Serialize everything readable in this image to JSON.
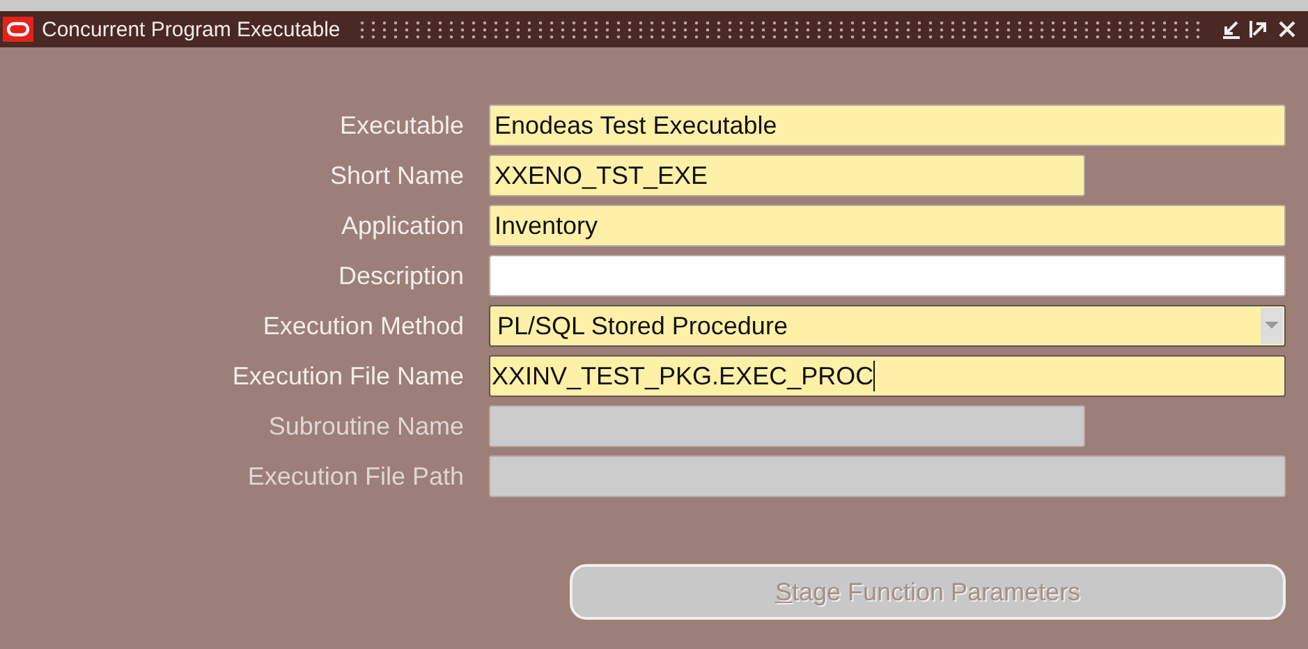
{
  "window": {
    "title": "Concurrent Program Executable"
  },
  "fields": [
    {
      "label": "Executable",
      "value": "Enodeas Test Executable",
      "kind": "text",
      "required": true,
      "disabled": false,
      "wide": true,
      "focused": false
    },
    {
      "label": "Short Name",
      "value": "XXENO_TST_EXE",
      "kind": "text",
      "required": true,
      "disabled": false,
      "wide": false,
      "focused": false
    },
    {
      "label": "Application",
      "value": "Inventory",
      "kind": "text",
      "required": true,
      "disabled": false,
      "wide": true,
      "focused": false
    },
    {
      "label": "Description",
      "kind": "text",
      "required": false,
      "disabled": false,
      "wide": true,
      "focused": false
    },
    {
      "label": "Execution Method",
      "value": "PL/SQL Stored Procedure",
      "kind": "list",
      "required": true,
      "disabled": false,
      "wide": true,
      "focused": false
    },
    {
      "label": "Execution File Name",
      "value": "XXINV_TEST_PKG.EXEC_PROC",
      "kind": "text",
      "required": true,
      "disabled": false,
      "wide": true,
      "focused": true
    },
    {
      "label": "Subroutine Name",
      "kind": "text",
      "required": false,
      "disabled": true,
      "wide": false,
      "focused": false
    },
    {
      "label": "Execution File Path",
      "kind": "text",
      "required": false,
      "disabled": true,
      "wide": true,
      "focused": false
    }
  ],
  "button": {
    "label": "Stage Function Parameters",
    "disabled": true,
    "mnemonic": true
  }
}
